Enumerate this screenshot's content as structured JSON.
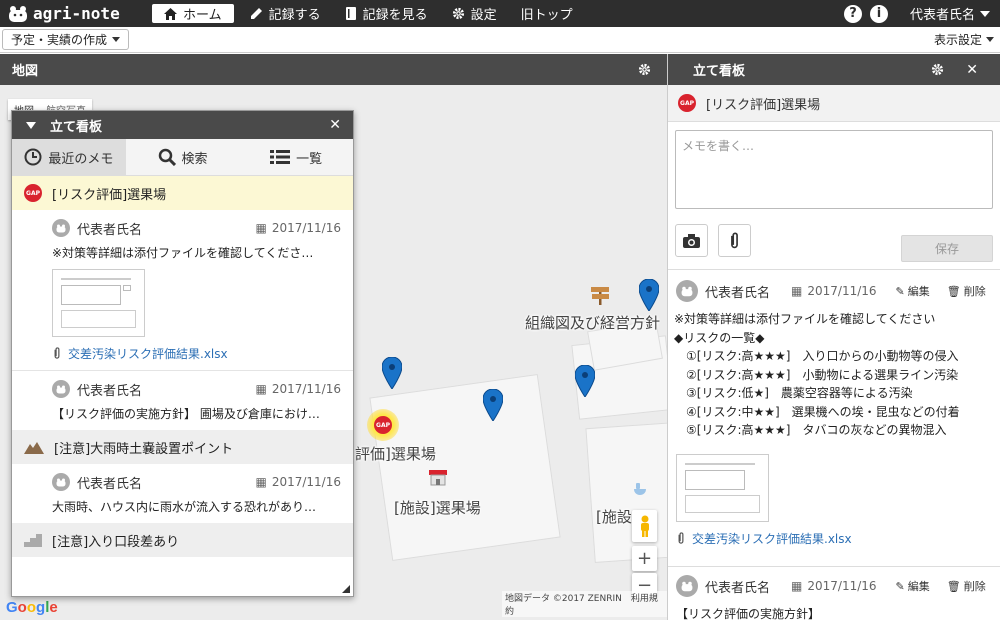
{
  "header": {
    "logo": "agri-note",
    "nav": [
      "ホーム",
      "記録する",
      "記録を見る",
      "設定",
      "旧トップ"
    ],
    "user": "代表者氏名"
  },
  "subbar": {
    "plan_label": "予定・実績の作成",
    "display_label": "表示設定"
  },
  "map": {
    "title": "地図",
    "tabs": [
      "地図",
      "航空写真"
    ],
    "labels": [
      "組織図及び経営方針",
      "ク評価]選果場",
      "[施設]選果場",
      "[施設]"
    ],
    "gap_badge": "GAP",
    "copyright": "地図データ ©2017 ZENRIN",
    "terms": "利用規約",
    "google": "Google",
    "zoom_in": "+",
    "zoom_out": "−"
  },
  "board": {
    "title": "立て看板",
    "tabs": [
      "最近のメモ",
      "検索",
      "一覧"
    ],
    "threads": [
      {
        "title": "[リスク評価]選果場",
        "icon": "GAP"
      },
      {
        "title": "[注意]大雨時土嚢設置ポイント"
      },
      {
        "title": "[注意]入り口段差あり"
      }
    ],
    "memos": [
      {
        "author": "代表者氏名",
        "date": "2017/11/16",
        "text": "※対策等詳細は添付ファイルを確認してくださ…",
        "file": "交差汚染リスク評価結果.xlsx"
      },
      {
        "author": "代表者氏名",
        "date": "2017/11/16",
        "text": "【リスク評価の実施方針】 圃場及び倉庫におけ…"
      },
      {
        "author": "代表者氏名",
        "date": "2017/11/16",
        "text": "大雨時、ハウス内に雨水が流入する恐れがあり…"
      }
    ]
  },
  "panel": {
    "title": "立て看板",
    "thread_title": "[リスク評価]選果場",
    "placeholder": "メモを書く…",
    "save": "保存",
    "edit": "編集",
    "delete": "削除",
    "memos": [
      {
        "author": "代表者氏名",
        "date": "2017/11/16",
        "lines": [
          "※対策等詳細は添付ファイルを確認してください",
          "◆リスクの一覧◆",
          "①[リスク:高★★★]　入り口からの小動物等の侵入",
          "②[リスク:高★★★]　小動物による選果ライン汚染",
          "③[リスク:低★]　農薬空容器等による汚染",
          "④[リスク:中★★]　選果機への埃・昆虫などの付着",
          "⑤[リスク:高★★★]　タバコの灰などの異物混入"
        ],
        "file": "交差汚染リスク評価結果.xlsx"
      },
      {
        "author": "代表者氏名",
        "date": "2017/11/16",
        "lines": [
          "【リスク評価の実施方針】"
        ]
      }
    ]
  },
  "colors": {
    "header_bg": "#2e2e2e",
    "pin": "#1a73c8",
    "gap_red": "#d9232e",
    "link": "#2c6fb5",
    "highlight": "#fcf8d4"
  }
}
